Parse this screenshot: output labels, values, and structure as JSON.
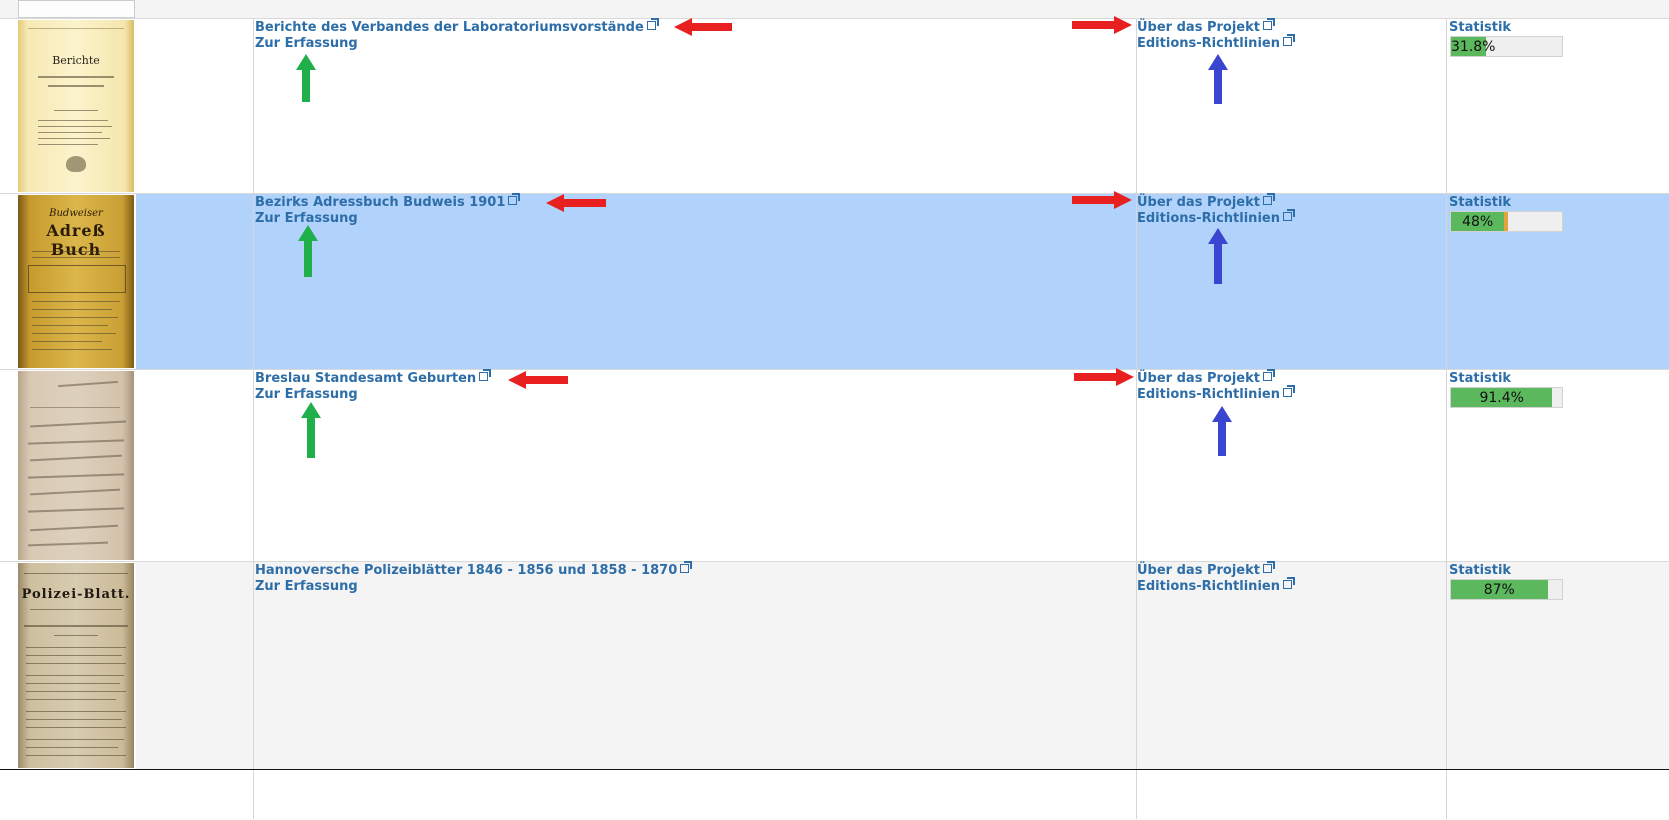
{
  "rows": [
    {
      "title": "Berichte des Verbandes der Laboratoriumsvorstände",
      "capture_link": "Zur Erfassung",
      "about_link": "Über das Projekt",
      "guidelines_link": "Editions-Richtlinien",
      "stats_link": "Statistik",
      "progress_label": "31.8%",
      "progress": 0.318
    },
    {
      "title": "Bezirks Adressbuch Budweis 1901",
      "capture_link": "Zur Erfassung",
      "about_link": "Über das Projekt",
      "guidelines_link": "Editions-Richtlinien",
      "stats_link": "Statistik",
      "progress_label": "48%",
      "progress": 0.48,
      "progress_review": 0.03
    },
    {
      "title": "Breslau Standesamt Geburten",
      "capture_link": "Zur Erfassung",
      "about_link": "Über das Projekt",
      "guidelines_link": "Editions-Richtlinien",
      "stats_link": "Statistik",
      "progress_label": "91.4%",
      "progress": 0.914
    },
    {
      "title": "Hannoversche Polizeiblätter 1846 - 1856 und 1858 - 1870",
      "capture_link": "Zur Erfassung",
      "about_link": "Über das Projekt",
      "guidelines_link": "Editions-Richtlinien",
      "stats_link": "Statistik",
      "progress_label": "87%",
      "progress": 0.87
    }
  ],
  "thumbnails": {
    "berichte": {
      "heading": "Berichte"
    },
    "budweis": {
      "heading_line1": "Budweiser",
      "heading_line2": "Adreß Buch"
    },
    "hannover": {
      "heading_line1": "Polizei-Blatt."
    }
  },
  "colors": {
    "link": "#2e6ea8",
    "selected_row": "#b0d2fb",
    "progress_fill": "#5cb85c",
    "annotation_red": "#e82020",
    "annotation_green": "#1fb04c",
    "annotation_blue": "#3a45d0"
  }
}
